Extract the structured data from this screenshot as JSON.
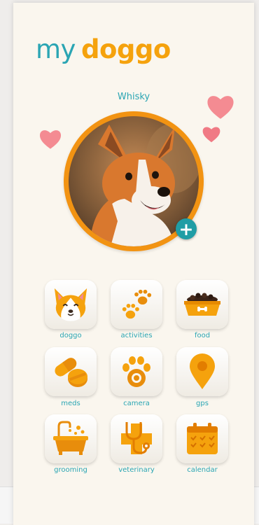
{
  "app": {
    "logo_my": "my",
    "logo_doggo": "doggo",
    "pet_name": "Whisky"
  },
  "menu": [
    {
      "label": "doggo",
      "icon": "corgi-face-icon"
    },
    {
      "label": "activities",
      "icon": "paw-prints-icon"
    },
    {
      "label": "food",
      "icon": "food-bowl-icon"
    },
    {
      "label": "meds",
      "icon": "pills-icon"
    },
    {
      "label": "camera",
      "icon": "paw-camera-icon"
    },
    {
      "label": "gps",
      "icon": "location-pin-icon"
    },
    {
      "label": "grooming",
      "icon": "bathtub-icon"
    },
    {
      "label": "veterinary",
      "icon": "stethoscope-icon"
    },
    {
      "label": "calendar",
      "icon": "calendar-icon"
    }
  ],
  "colors": {
    "brand_teal": "#2aa5b3",
    "brand_orange": "#f5a20d",
    "heart_pink": "#f48b92",
    "background": "#faf6ee"
  }
}
